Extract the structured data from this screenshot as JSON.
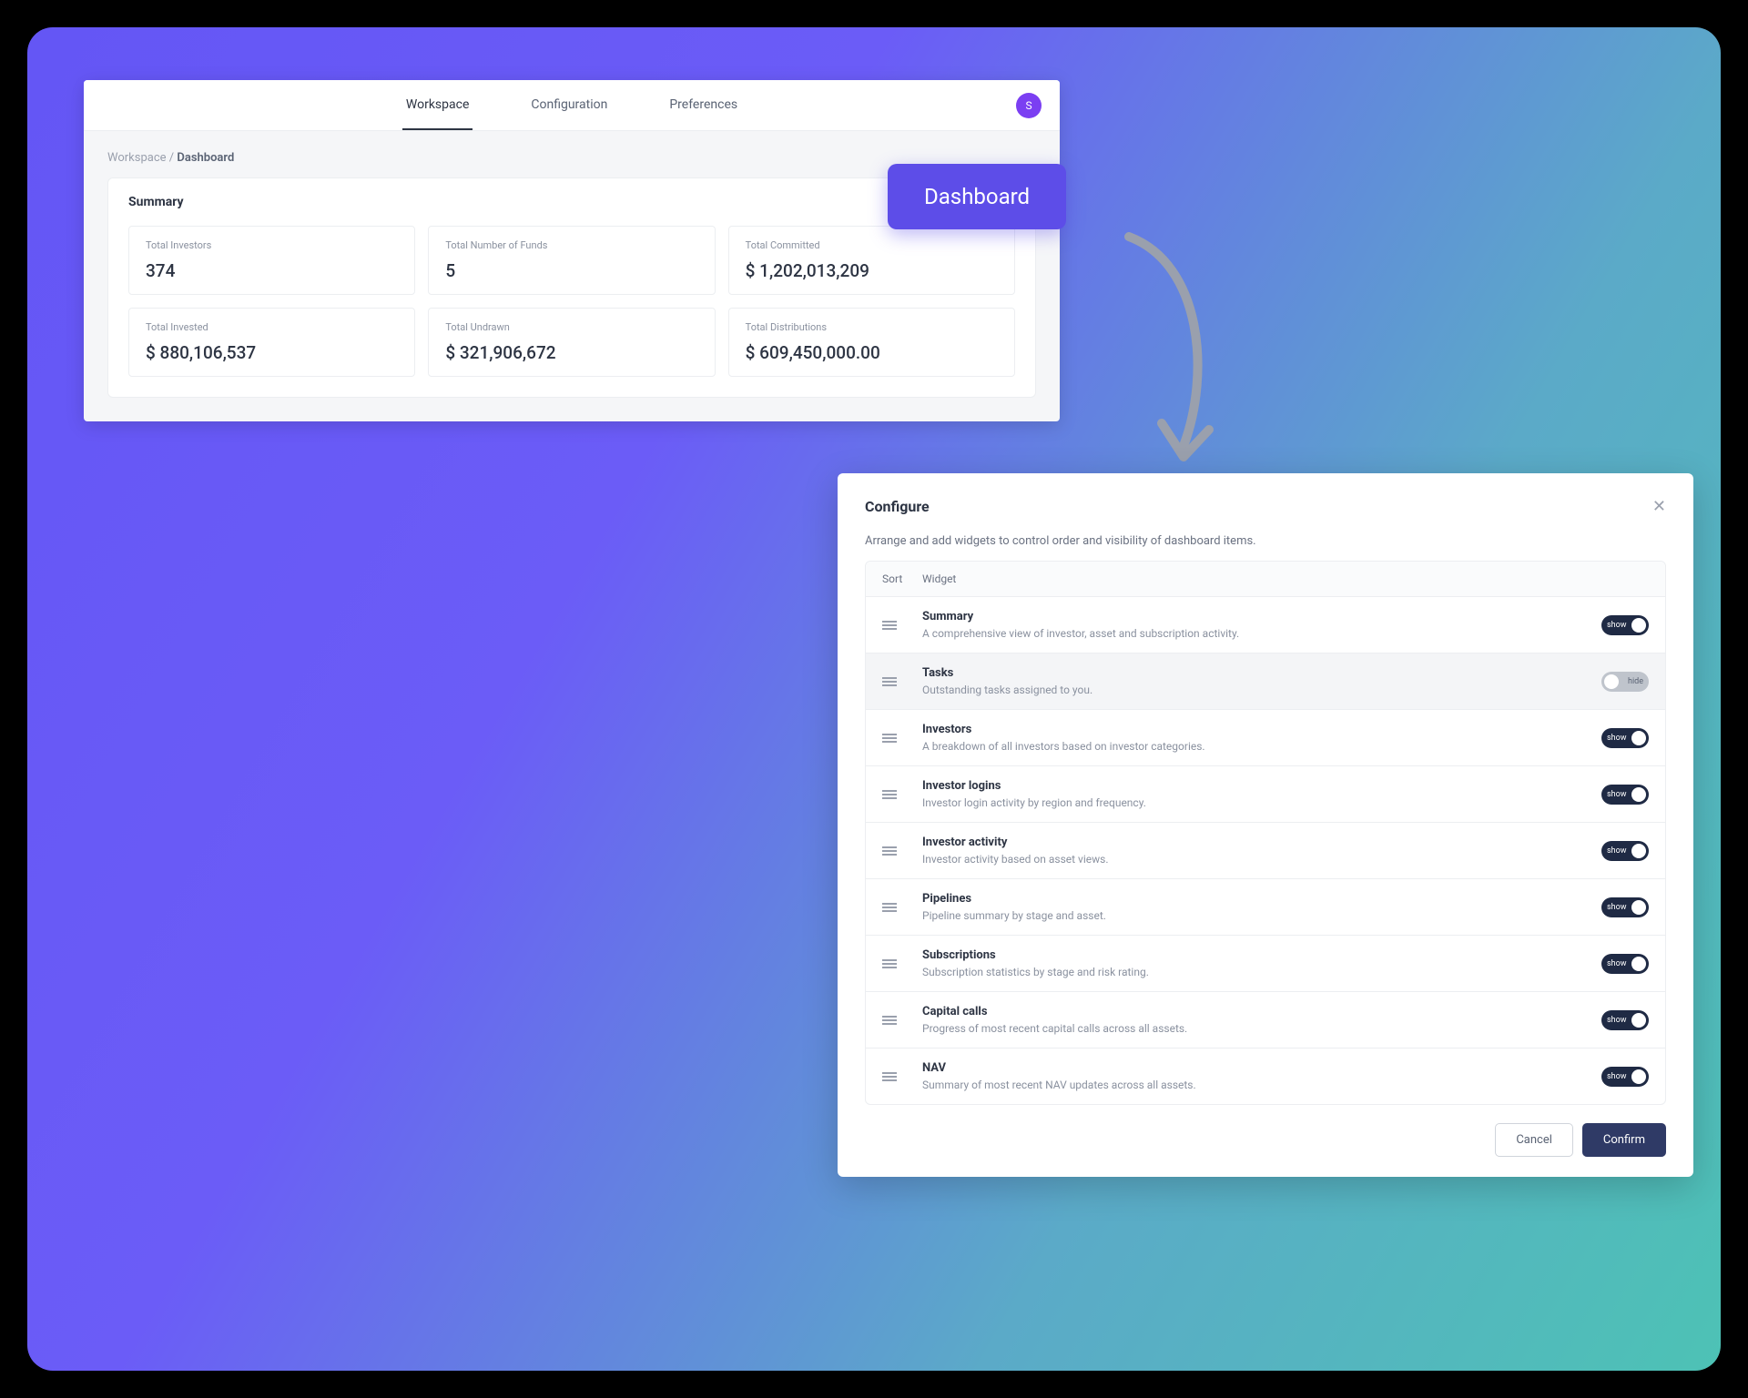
{
  "nav": {
    "tabs": [
      "Workspace",
      "Configuration",
      "Preferences"
    ],
    "avatar_letter": "S"
  },
  "breadcrumb": {
    "root": "Workspace",
    "sep": "/",
    "current": "Dashboard"
  },
  "summary": {
    "title": "Summary",
    "stats": [
      {
        "label": "Total Investors",
        "value": "374"
      },
      {
        "label": "Total Number of Funds",
        "value": "5"
      },
      {
        "label": "Total Committed",
        "value": "$ 1,202,013,209"
      },
      {
        "label": "Total Invested",
        "value": "$ 880,106,537"
      },
      {
        "label": "Total Undrawn",
        "value": "$ 321,906,672"
      },
      {
        "label": "Total Distributions",
        "value": "$ 609,450,000.00"
      }
    ]
  },
  "badge": "Dashboard",
  "configure": {
    "title": "Configure",
    "description": "Arrange and add widgets to control order and visibility of dashboard items.",
    "head_sort": "Sort",
    "head_widget": "Widget",
    "show_label": "show",
    "hide_label": "hide",
    "widgets": [
      {
        "name": "Summary",
        "desc": "A comprehensive view of investor, asset and subscription activity.",
        "on": true
      },
      {
        "name": "Tasks",
        "desc": "Outstanding tasks assigned to you.",
        "on": false
      },
      {
        "name": "Investors",
        "desc": "A breakdown of all investors based on investor categories.",
        "on": true
      },
      {
        "name": "Investor logins",
        "desc": "Investor login activity by region and frequency.",
        "on": true
      },
      {
        "name": "Investor activity",
        "desc": "Investor activity based on asset views.",
        "on": true
      },
      {
        "name": "Pipelines",
        "desc": "Pipeline summary by stage and asset.",
        "on": true
      },
      {
        "name": "Subscriptions",
        "desc": "Subscription statistics by stage and risk rating.",
        "on": true
      },
      {
        "name": "Capital calls",
        "desc": "Progress of most recent capital calls across all assets.",
        "on": true
      },
      {
        "name": "NAV",
        "desc": "Summary of most recent NAV updates across all assets.",
        "on": true
      }
    ],
    "cancel": "Cancel",
    "confirm": "Confirm"
  }
}
